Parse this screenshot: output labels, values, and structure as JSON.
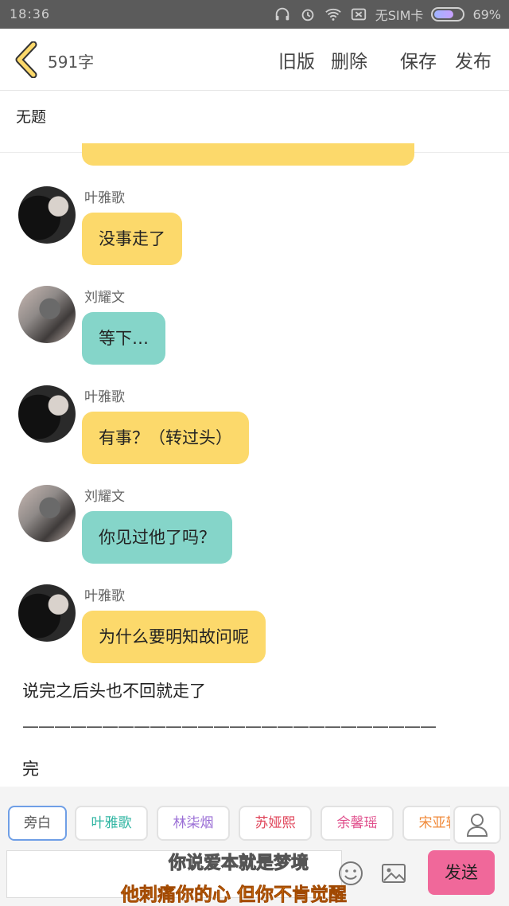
{
  "status_bar": {
    "time": "18:36",
    "sim": "无SIM卡",
    "battery": "69%",
    "battery_level": 0.69
  },
  "header": {
    "word_count": "591字",
    "old_version": "旧版",
    "delete": "删除",
    "save": "保存",
    "publish": "发布"
  },
  "title": "无题",
  "messages": [
    {
      "speaker": "叶雅歌",
      "text": "没事走了",
      "bubble_color": "#fcd96b"
    },
    {
      "speaker": "刘耀文",
      "text": "等下…",
      "bubble_color": "#85d5c9"
    },
    {
      "speaker": "叶雅歌",
      "text": "有事？（转过头）",
      "bubble_color": "#fcd96b"
    },
    {
      "speaker": "刘耀文",
      "text": "你见过他了吗？",
      "bubble_color": "#85d5c9"
    },
    {
      "speaker": "叶雅歌",
      "text": "为什么要明知故问呢",
      "bubble_color": "#fcd96b"
    }
  ],
  "narration": "说完之后头也不回就走了",
  "divider": "——————————————————————————",
  "end": "完",
  "role_chips": [
    {
      "label": "旁白",
      "color": "#555555"
    },
    {
      "label": "叶雅歌",
      "color": "#2fb5a2"
    },
    {
      "label": "林柒烟",
      "color": "#9b6fd6"
    },
    {
      "label": "苏娅熙",
      "color": "#e0455a"
    },
    {
      "label": "余馨瑶",
      "color": "#e04f8c"
    },
    {
      "label": "宋亚轩",
      "color": "#f08a3a"
    }
  ],
  "send_label": "发送",
  "overlay": {
    "line1": "你说爱本就是梦境",
    "line2": "他刺痛你的心 但你不肯觉醒"
  }
}
